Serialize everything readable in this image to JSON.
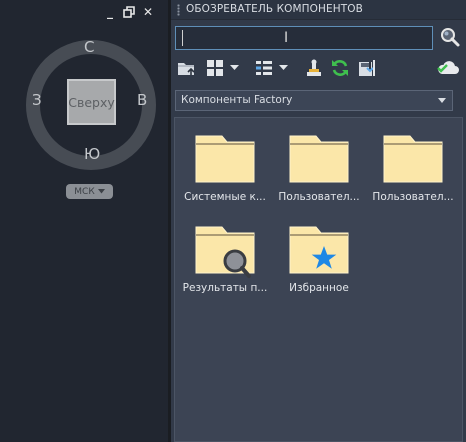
{
  "viewport": {
    "compass": {
      "north": "С",
      "south": "Ю",
      "east": "В",
      "west": "З"
    },
    "viewcube_face": "Сверху",
    "wcs_label": "МСК"
  },
  "palette": {
    "title": "ОБОЗРЕВАТЕЛЬ КОМПОНЕНТОВ",
    "search": {
      "value": "",
      "placeholder": ""
    },
    "library_selector": "Компоненты Factory",
    "items": [
      {
        "label": "Системные к...",
        "icon": "folder-icon"
      },
      {
        "label": "Пользовател...",
        "icon": "folder-icon"
      },
      {
        "label": "Пользовател...",
        "icon": "folder-icon"
      },
      {
        "label": "Результаты п...",
        "icon": "search-results-folder-icon"
      },
      {
        "label": "Избранное",
        "icon": "favorites-folder-icon"
      }
    ]
  },
  "colors": {
    "accent": "#5f8fb8",
    "folder_fill": "#fbe7a9",
    "star": "#1e88e5",
    "refresh": "#3fbf4e"
  }
}
